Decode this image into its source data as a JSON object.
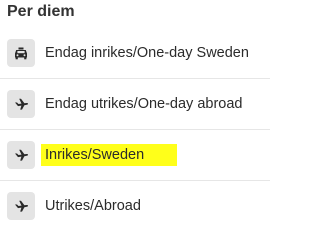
{
  "header": {
    "title": "Per diem"
  },
  "items": [
    {
      "label": "Endag inrikes/One-day Sweden",
      "icon": "taxi-icon",
      "highlighted": false
    },
    {
      "label": "Endag utrikes/One-day abroad",
      "icon": "airplane-icon",
      "highlighted": false
    },
    {
      "label": "Inrikes/Sweden",
      "icon": "airplane-icon",
      "highlighted": true
    },
    {
      "label": "Utrikes/Abroad",
      "icon": "airplane-icon",
      "highlighted": false
    }
  ],
  "colors": {
    "highlight": "#ffff1a",
    "icon_background": "#e4e4e4",
    "divider": "#e6e6e6",
    "text": "#2b2b2b"
  }
}
